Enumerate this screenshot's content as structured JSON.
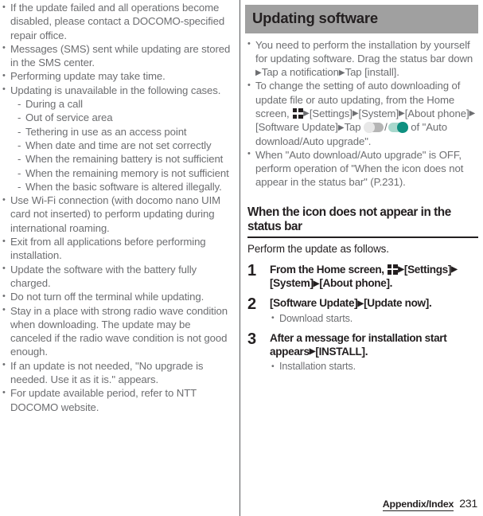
{
  "left_column": {
    "bullets": [
      {
        "text": "If the update failed and all operations become disabled, please contact a DOCOMO-specified repair office."
      },
      {
        "text": "Messages (SMS) sent while updating are stored in the SMS center."
      },
      {
        "text": "Performing update may take time."
      },
      {
        "text": "Updating is unavailable in the following cases.",
        "sub_items": [
          "During a call",
          "Out of service area",
          "Tethering in use as an access point",
          "When date and time are not set correctly",
          "When the remaining battery is not sufficient",
          "When the remaining memory is not sufficient",
          "When the basic software is altered illegally."
        ]
      },
      {
        "text": "Use Wi-Fi connection (with docomo nano UIM card not inserted) to perform updating during international roaming."
      },
      {
        "text": "Exit from all applications before performing installation."
      },
      {
        "text": "Update the software with the battery fully charged."
      },
      {
        "text": "Do not turn off the terminal while updating."
      },
      {
        "text": "Stay in a place with strong radio wave condition when downloading. The update may be canceled if the radio wave condition is not good enough."
      },
      {
        "text": "If an update is not needed, \"No upgrade is needed. Use it as it is.\" appears."
      },
      {
        "text": "For update available period, refer to NTT DOCOMO website."
      }
    ]
  },
  "right_column": {
    "heading": "Updating software",
    "bullet_1": {
      "part_1": "You need to perform the installation by yourself for updating software. Drag the status bar down",
      "part_2": "Tap a notification",
      "part_3": "Tap [install]."
    },
    "bullet_2": {
      "part_1": "To change the setting of auto downloading of update file or auto updating, from the Home screen,",
      "part_2": "[Settings]",
      "part_3": "[System]",
      "part_4": "[About phone]",
      "part_5": "[Software Update]",
      "part_6": "Tap",
      "separator": "/",
      "part_7": "of \"Auto download/Auto upgrade\"."
    },
    "bullet_3": {
      "text": "When \"Auto download/Auto upgrade\" is OFF, perform operation of \"When the icon does not appear in the status bar\" (P.231)."
    },
    "subheading": "When the icon does not appear in the status bar",
    "lead": "Perform the update as follows.",
    "steps": [
      {
        "number": "1",
        "title_part_1": "From the Home screen,",
        "title_part_2": "[Settings]",
        "title_part_3": "[System]",
        "title_part_4": "[About phone].",
        "note": ""
      },
      {
        "number": "2",
        "title_part_1": "[Software Update]",
        "title_part_2": "[Update now].",
        "note": "Download starts."
      },
      {
        "number": "3",
        "title_part_1": "After a message for installation start appears",
        "title_part_2": "[INSTALL].",
        "note": "Installation starts."
      }
    ]
  },
  "icons": {
    "app_grid": "app-grid-icon",
    "triangle": "▶",
    "toggle_off": "toggle-off-icon",
    "toggle_on": "toggle-on-icon"
  },
  "footer": {
    "section": "Appendix/Index",
    "page_number": "231"
  },
  "colors": {
    "band_background": "#a0a0a0",
    "body_text": "#6d6e71",
    "heading_text": "#231f20",
    "toggle_on_knob": "#0e9080",
    "toggle_on_track": "#a9d8cd",
    "toggle_off_track": "#b5b5b5"
  }
}
